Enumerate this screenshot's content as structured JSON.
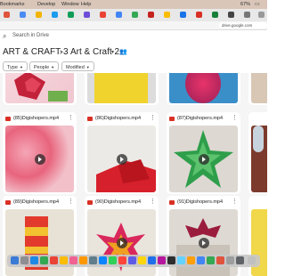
{
  "menubar": {
    "items": [
      "Bookmarks",
      "Develop",
      "Window",
      "Help"
    ],
    "status": "67%"
  },
  "browser": {
    "url": "drive.google.com"
  },
  "search": {
    "placeholder": "Search in Drive"
  },
  "breadcrumb": {
    "parent": "ART & CRAFT-3",
    "current": "Art & Craft 2"
  },
  "filters": [
    "Type",
    "People",
    "Modified"
  ],
  "files": {
    "row2": [
      "(85)Digishopers.mp4",
      "(86)Digishopers.mp4",
      "(87)Digishopers.mp4"
    ],
    "row3": [
      "(89)Digishopers.mp4",
      "(90)Digishopers.mp4",
      "(91)Digishopers.mp4"
    ]
  },
  "icons": {
    "search": "search-icon",
    "more": "more-vert-icon",
    "video": "video-file-icon",
    "play": "play-icon",
    "share": "shared-folder-icon",
    "dropdown": "chevron-down-icon"
  }
}
